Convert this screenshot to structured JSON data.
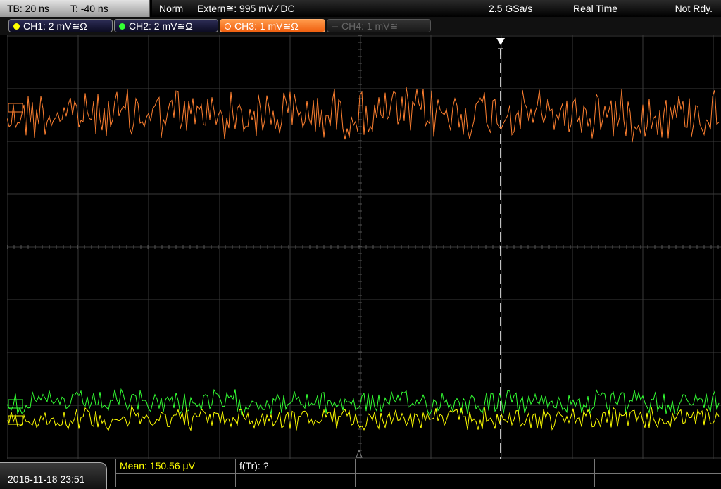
{
  "header": {
    "timebase": "TB: 20 ns",
    "trigger_time": "T: -40 ns",
    "mode": "Norm",
    "trigger_source": "Extern≅: 995 mV ⁄ DC",
    "sample_rate": "2.5 GSa/s",
    "acquisition": "Real Time",
    "status": "Not Rdy."
  },
  "channels": [
    {
      "label": "CH1: 2 mV≅Ω",
      "color": "#ffff00",
      "active": true
    },
    {
      "label": "CH2: 2 mV≅Ω",
      "color": "#33ff33",
      "active": true
    },
    {
      "label": "CH3: 1 mV≅Ω",
      "color": "#ff8030",
      "active": true,
      "selected": true
    },
    {
      "label": "CH4: 1 mV≅",
      "color": "#555555",
      "active": false
    }
  ],
  "trigger_marker": "T",
  "footer": {
    "datetime": "2016-11-18  23:51",
    "measurements": {
      "mean": "Mean: 150.56 μV",
      "f_tr": "f(Tr): ?"
    }
  },
  "colors": {
    "ch1": "#ffff00",
    "ch2": "#33ff33",
    "ch3": "#ff8030",
    "grid": "#3a3a3a",
    "trigger_line": "#ffffff"
  }
}
